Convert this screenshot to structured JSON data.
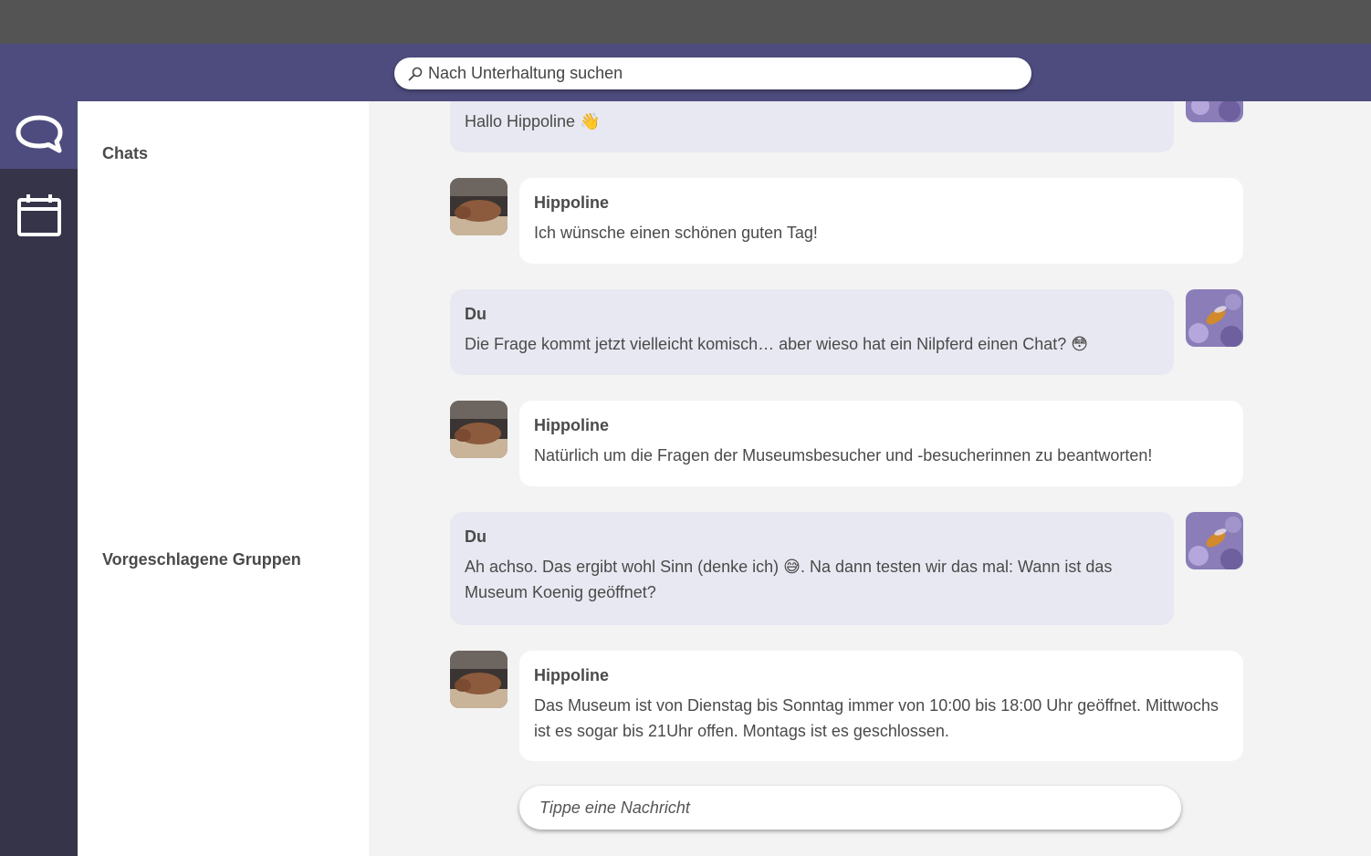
{
  "search": {
    "placeholder": "Nach Unterhaltung suchen",
    "icon": "magnifier-icon"
  },
  "rail": {
    "items": [
      {
        "name": "chats",
        "icon": "speech-bubble-icon",
        "active": true
      },
      {
        "name": "calendar",
        "icon": "calendar-icon",
        "active": false
      }
    ]
  },
  "sidebar": {
    "chats_title": "Chats",
    "groups_title": "Vorgeschlagene Gruppen"
  },
  "messages": [
    {
      "from": "me",
      "sender": "",
      "text": "Hallo Hippoline 👋"
    },
    {
      "from": "bot",
      "sender": "Hippoline",
      "text": "Ich wünsche einen schönen guten Tag!"
    },
    {
      "from": "me",
      "sender": "Du",
      "text": "Die Frage kommt jetzt vielleicht komisch… aber wieso hat ein Nilpferd einen Chat? 😳"
    },
    {
      "from": "bot",
      "sender": "Hippoline",
      "text": "Natürlich um die Fragen der Museumsbesucher und -besucherinnen zu beantworten!"
    },
    {
      "from": "me",
      "sender": "Du",
      "text": "Ah achso. Das ergibt wohl Sinn (denke ich) 😅. Na dann testen wir das mal: Wann ist das Museum Koenig geöffnet?"
    },
    {
      "from": "bot",
      "sender": "Hippoline",
      "text": "Das Museum ist von Dienstag bis Sonntag immer von 10:00 bis 18:00 Uhr geöffnet. Mittwochs ist es sogar bis 21Uhr offen. Montags ist es geschlossen."
    }
  ],
  "composer": {
    "placeholder": "Tippe eine Nachricht"
  },
  "colors": {
    "header": "#4e4c7e",
    "rail": "#353449",
    "my_bubble": "#e8e8f2",
    "bot_bubble": "#ffffff"
  }
}
